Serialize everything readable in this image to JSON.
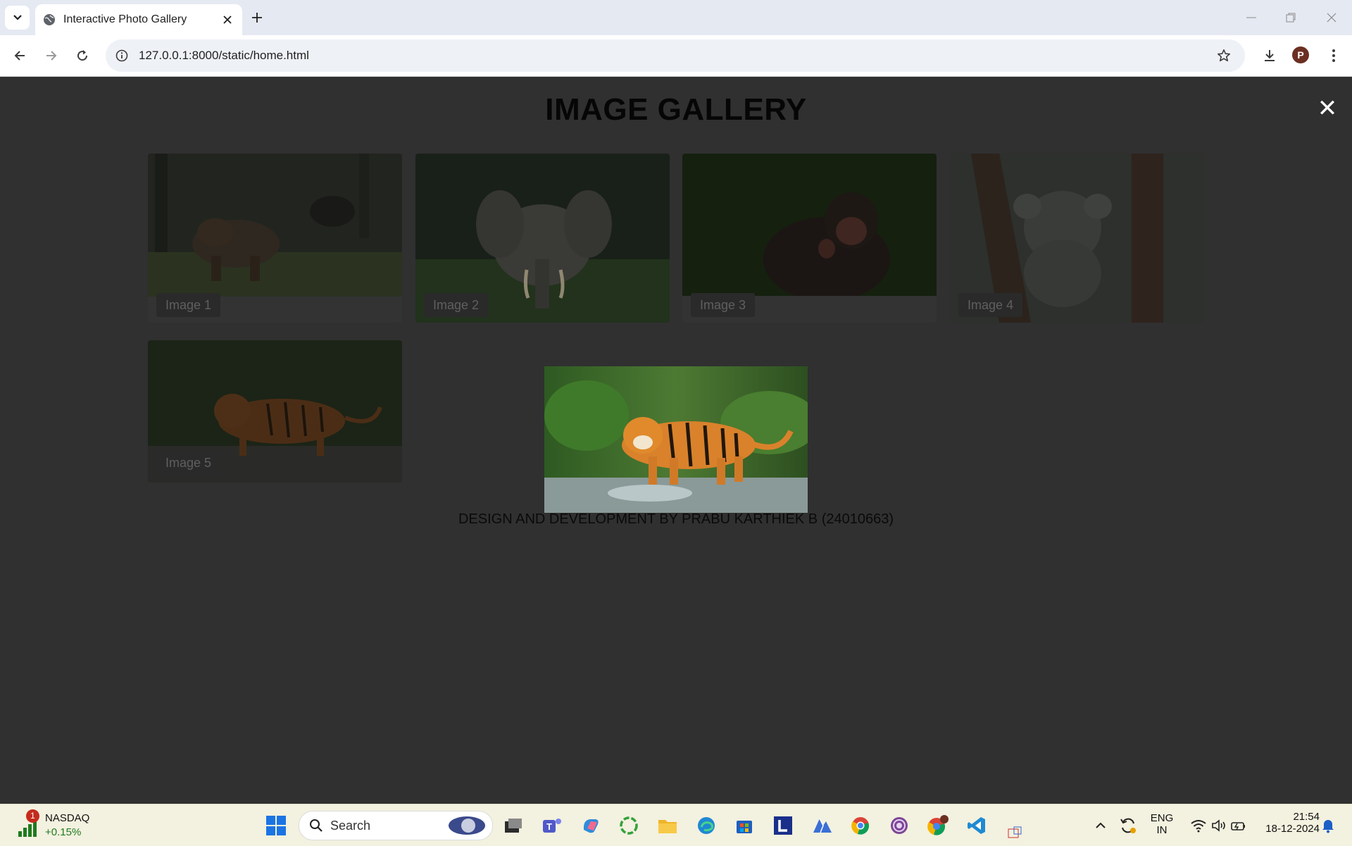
{
  "browser": {
    "tab_title": "Interactive Photo Gallery",
    "url": "127.0.0.1:8000/static/home.html",
    "profile_initial": "P"
  },
  "page": {
    "title": "IMAGE GALLERY",
    "close_symbol": "✕",
    "footer": "DESIGN AND DEVELOPMENT BY PRABU KARTHIEK B (24010663)",
    "images": [
      {
        "caption": "Image 1",
        "subject": "bear"
      },
      {
        "caption": "Image 2",
        "subject": "elephant"
      },
      {
        "caption": "Image 3",
        "subject": "chimpanzee"
      },
      {
        "caption": "Image 4",
        "subject": "koala"
      },
      {
        "caption": "Image 5",
        "subject": "tiger"
      }
    ],
    "lightbox": {
      "subject": "tiger"
    }
  },
  "taskbar": {
    "ticker_name": "NASDAQ",
    "ticker_change": "+0.15%",
    "ticker_badge": "1",
    "search_label": "Search",
    "language_top": "ENG",
    "language_bottom": "IN",
    "time": "21:54",
    "date": "18-12-2024"
  }
}
